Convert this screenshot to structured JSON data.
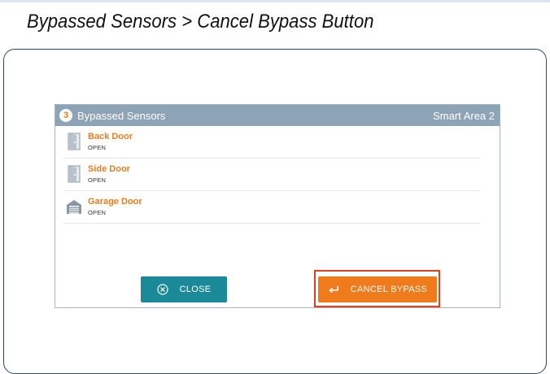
{
  "doc": {
    "heading": "Bypassed Sensors > Cancel Bypass Button"
  },
  "dialog": {
    "count": "3",
    "title": "Bypassed Sensors",
    "area": "Smart Area 2"
  },
  "sensors": [
    {
      "name": "Back Door",
      "status": "OPEN",
      "icon": "door-icon"
    },
    {
      "name": "Side Door",
      "status": "OPEN",
      "icon": "door-icon"
    },
    {
      "name": "Garage Door",
      "status": "OPEN",
      "icon": "garage-icon"
    }
  ],
  "buttons": {
    "close_label": "CLOSE",
    "close_icon": "close-circle-icon",
    "cancel_label": "CANCEL BYPASS",
    "cancel_icon": "return-arrow-icon"
  },
  "colors": {
    "header": "#8da3b6",
    "accent_orange": "#f07b1d",
    "close_teal": "#1a8a99",
    "highlight_red": "#e0421f",
    "frame_navy": "#2d4a64"
  }
}
